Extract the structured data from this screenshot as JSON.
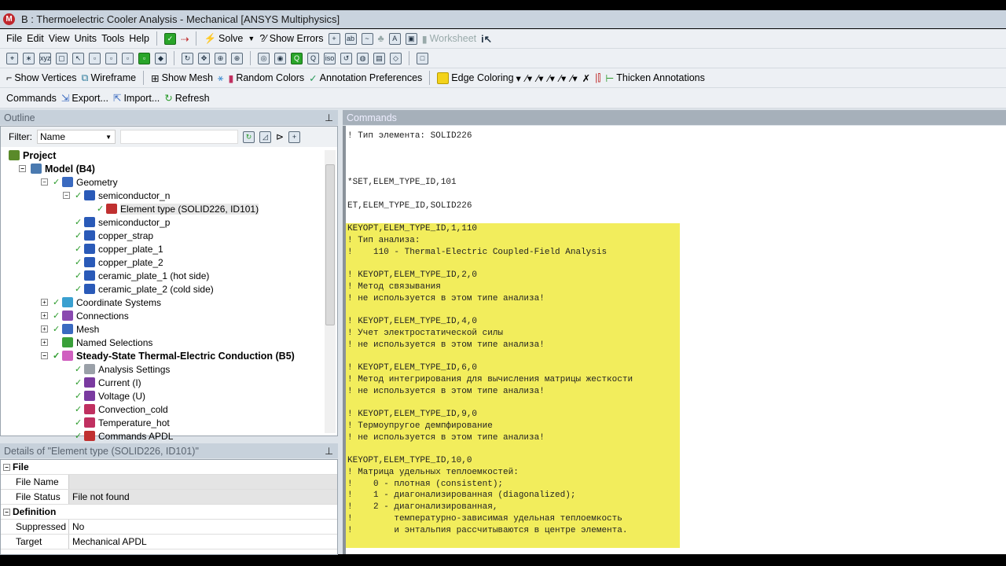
{
  "window": {
    "title": "B : Thermoelectric Cooler Analysis - Mechanical [ANSYS Multiphysics]",
    "logo": "M"
  },
  "menu": [
    "File",
    "Edit",
    "View",
    "Units",
    "Tools",
    "Help"
  ],
  "toolbar1": {
    "solve": "Solve",
    "show_errors": "?⁄ Show Errors",
    "worksheet": "Worksheet"
  },
  "toolbar3": {
    "show_vertices": "Show Vertices",
    "wireframe": "Wireframe",
    "show_mesh": "Show Mesh",
    "random_colors": "Random Colors",
    "annotation_preferences": "Annotation Preferences",
    "edge_coloring": "Edge Coloring",
    "thicken_annotations": "Thicken Annotations"
  },
  "toolbar4": {
    "commands": "Commands",
    "export": "Export...",
    "import": "Import...",
    "refresh": "Refresh"
  },
  "outline": {
    "title": "Outline",
    "filter_label": "Filter:",
    "filter_value": "Name",
    "tree": [
      {
        "label": "Project",
        "level": 0,
        "bold": true,
        "color": "#5a8a2a"
      },
      {
        "label": "Model (B4)",
        "level": 1,
        "bold": true,
        "exp": "−",
        "color": "#4a7ab0"
      },
      {
        "label": "Geometry",
        "level": 2,
        "exp": "−",
        "check": true,
        "color": "#3a6ac0"
      },
      {
        "label": "semiconductor_n",
        "level": 3,
        "exp": "−",
        "check": true,
        "color": "#2a5ab8"
      },
      {
        "label": "Element type (SOLID226, ID101)",
        "level": 4,
        "check": true,
        "color": "#c03030",
        "selected": true
      },
      {
        "label": "semiconductor_p",
        "level": 3,
        "check": true,
        "color": "#2a5ab8"
      },
      {
        "label": "copper_strap",
        "level": 3,
        "check": true,
        "color": "#2a5ab8"
      },
      {
        "label": "copper_plate_1",
        "level": 3,
        "check": true,
        "color": "#2a5ab8"
      },
      {
        "label": "copper_plate_2",
        "level": 3,
        "check": true,
        "color": "#2a5ab8"
      },
      {
        "label": "ceramic_plate_1 (hot side)",
        "level": 3,
        "check": true,
        "color": "#2a5ab8"
      },
      {
        "label": "ceramic_plate_2 (cold side)",
        "level": 3,
        "check": true,
        "color": "#2a5ab8"
      },
      {
        "label": "Coordinate Systems",
        "level": 2,
        "exp": "+",
        "check": true,
        "color": "#3aa0d0"
      },
      {
        "label": "Connections",
        "level": 2,
        "exp": "+",
        "check": true,
        "color": "#8a4ab0"
      },
      {
        "label": "Mesh",
        "level": 2,
        "exp": "+",
        "check": true,
        "color": "#3a6ac0"
      },
      {
        "label": "Named Selections",
        "level": 2,
        "exp": "+",
        "check": false,
        "color": "#3aa03a"
      },
      {
        "label": "Steady-State Thermal-Electric Conduction (B5)",
        "level": 2,
        "exp": "−",
        "check": true,
        "bold": true,
        "color": "#d060c0"
      },
      {
        "label": "Analysis Settings",
        "level": 3,
        "check": true,
        "color": "#9aa0a8"
      },
      {
        "label": "Current (I)",
        "level": 3,
        "check": true,
        "color": "#7a3aa0"
      },
      {
        "label": "Voltage (U)",
        "level": 3,
        "check": true,
        "color": "#7a3aa0"
      },
      {
        "label": "Convection_cold",
        "level": 3,
        "check": true,
        "color": "#c03060"
      },
      {
        "label": "Temperature_hot",
        "level": 3,
        "check": true,
        "color": "#c03060"
      },
      {
        "label": "Commands APDL",
        "level": 3,
        "check": true,
        "color": "#c03030"
      }
    ]
  },
  "details": {
    "title": "Details of \"Element type (SOLID226, ID101)\"",
    "rows": [
      {
        "type": "cat",
        "key": "File"
      },
      {
        "key": "File Name",
        "value": "",
        "grey": true
      },
      {
        "key": "File Status",
        "value": "File not found",
        "grey": true
      },
      {
        "type": "cat",
        "key": "Definition"
      },
      {
        "key": "Suppressed",
        "value": "No"
      },
      {
        "key": "Target",
        "value": "Mechanical APDL"
      }
    ]
  },
  "commands": {
    "title": "Commands",
    "lines": [
      {
        "t": "! Тип элемента: SOLID226"
      },
      {
        "t": ""
      },
      {
        "t": ""
      },
      {
        "t": ""
      },
      {
        "t": "*SET,ELEM_TYPE_ID,101"
      },
      {
        "t": ""
      },
      {
        "t": "ET,ELEM_TYPE_ID,SOLID226"
      },
      {
        "t": ""
      },
      {
        "t": "KEYOPT,ELEM_TYPE_ID,1,110",
        "hl": true
      },
      {
        "t": "! Тип анализа:",
        "hl": true
      },
      {
        "t": "!    110 - Thermal-Electric Coupled-Field Analysis",
        "hl": true
      },
      {
        "t": "",
        "hl": true
      },
      {
        "t": "! KEYOPT,ELEM_TYPE_ID,2,0",
        "hl": true
      },
      {
        "t": "! Метод связывания",
        "hl": true
      },
      {
        "t": "! не используется в этом типе анализа!",
        "hl": true
      },
      {
        "t": "",
        "hl": true
      },
      {
        "t": "! KEYOPT,ELEM_TYPE_ID,4,0",
        "hl": true
      },
      {
        "t": "! Учет электростатической силы",
        "hl": true
      },
      {
        "t": "! не используется в этом типе анализа!",
        "hl": true
      },
      {
        "t": "",
        "hl": true
      },
      {
        "t": "! KEYOPT,ELEM_TYPE_ID,6,0",
        "hl": true
      },
      {
        "t": "! Метод интегрирования для вычисления матрицы жесткости",
        "hl": true
      },
      {
        "t": "! не используется в этом типе анализа!",
        "hl": true
      },
      {
        "t": "",
        "hl": true
      },
      {
        "t": "! KEYOPT,ELEM_TYPE_ID,9,0",
        "hl": true
      },
      {
        "t": "! Термоупругое демпфирование",
        "hl": true
      },
      {
        "t": "! не используется в этом типе анализа!",
        "hl": true
      },
      {
        "t": "",
        "hl": true
      },
      {
        "t": "KEYOPT,ELEM_TYPE_ID,10,0",
        "hl": true
      },
      {
        "t": "! Матрица удельных теплоемкостей:",
        "hl": true
      },
      {
        "t": "!    0 - плотная (consistent);",
        "hl": true
      },
      {
        "t": "!    1 - диагонализированная (diagonalized);",
        "hl": true
      },
      {
        "t": "!    2 - диагонализированная,",
        "hl": true
      },
      {
        "t": "!        температурно-зависимая удельная теплоемкость",
        "hl": true
      },
      {
        "t": "!        и энтальпия рассчитываются в центре элемента.",
        "hl": true
      },
      {
        "t": "",
        "hl": true
      }
    ]
  }
}
